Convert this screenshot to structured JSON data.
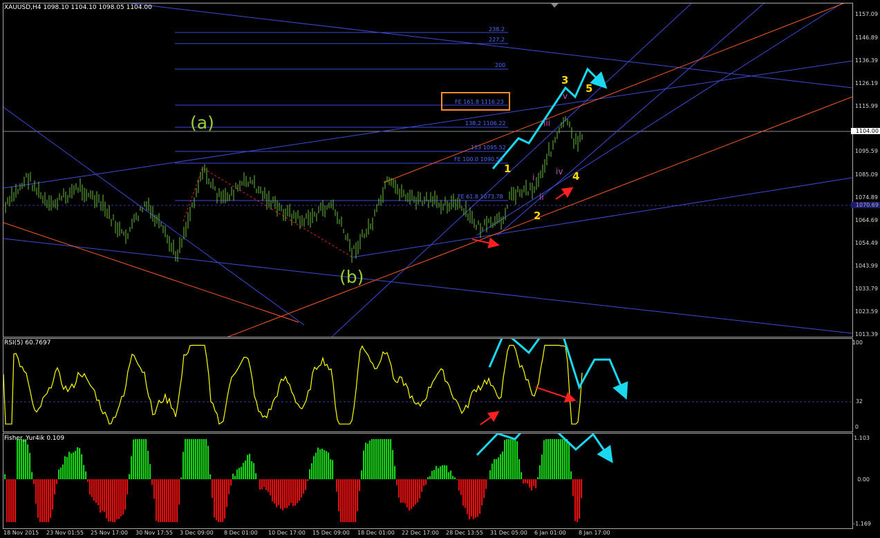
{
  "main_pane": {
    "title": "XAUUSD,H4  1098.10 1104.10 1098.05 1104.00",
    "price_axis": [
      "1157.09",
      "1146.89",
      "1136.39",
      "1126.19",
      "1115.99",
      "1095.59",
      "1085.09",
      "1074.89",
      "1064.69",
      "1054.49",
      "1043.99",
      "1033.79",
      "1023.59",
      "1013.39"
    ],
    "current_price": "1104.00",
    "bid_price": "1070.69",
    "fib_levels": [
      "238.2",
      "227.2",
      "200",
      "161.8 1116.23",
      "138.2 1106.22",
      "113 1095.52",
      "100.0 1090.50",
      "61.8 1073.78"
    ],
    "fe_box_label": "FE 161.8 1116.23",
    "fe_100_label": "FE 100.0 1090.50",
    "fe_61_label": "FE 61.8 1073.78",
    "fe_138_label": "138.2 1106.22",
    "fe_113_label": "113 1095.52",
    "waves": {
      "a": "(a)",
      "b": "(b)",
      "w1": "1",
      "w2": "2",
      "w3": "3",
      "w4": "4",
      "w5": "5",
      "si": "i",
      "sii": "ii",
      "siii": "iii",
      "siv": "iv",
      "sv": "v"
    }
  },
  "rsi_pane": {
    "title": "RSI(5) 60.7697",
    "levels": [
      "100",
      "32",
      "0"
    ]
  },
  "fisher_pane": {
    "title": "Fisher_Yur4ik 0.109",
    "levels": [
      "1.103",
      "0.00",
      "-1.169"
    ]
  },
  "time_axis": [
    "18 Nov 2015",
    "23 Nov 01:55",
    "25 Nov 17:00",
    "30 Nov 17:55",
    "3 Dec 09:00",
    "8 Dec 01:00",
    "10 Dec 17:00",
    "15 Dec 09:00",
    "18 Dec 01:00",
    "22 Dec 17:00",
    "28 Dec 13:55",
    "31 Dec 05:00",
    "6 Jan 01:00",
    "8 Jan 17:00"
  ],
  "colors": {
    "candle": "#6bbf3a",
    "trendline_blue": "#3c4cd8",
    "trendline_orange": "#ff5a1e",
    "arrow_cyan": "#19d8f0",
    "arrow_red": "#ff2020",
    "rsi_line": "#ffff00",
    "fisher_pos": "#19d119",
    "fisher_neg": "#e01010",
    "fe_box": "#ff8c2a"
  }
}
